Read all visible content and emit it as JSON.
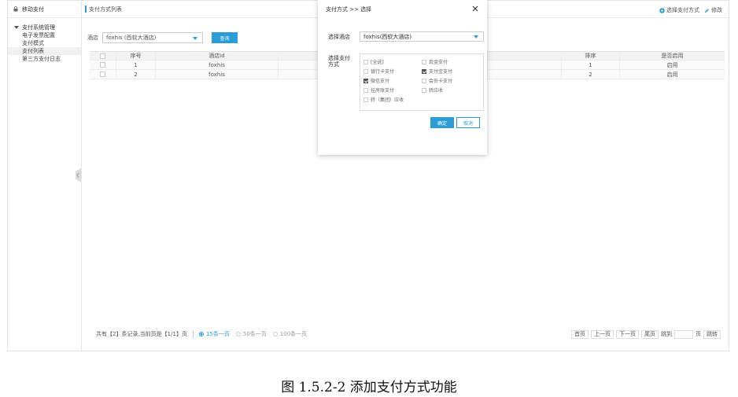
{
  "sidebar": {
    "header": "移动支付",
    "group": "支付系统管理",
    "items": [
      {
        "label": "电子发票配置",
        "active": false
      },
      {
        "label": "支付模式",
        "active": false
      },
      {
        "label": "支付列表",
        "active": true
      },
      {
        "label": "第三方支付日志",
        "active": false
      }
    ]
  },
  "topbar": {
    "title": "支付方式列表",
    "select_pay_label": "选择支付方式",
    "edit_label": "修改"
  },
  "filter": {
    "label": "酒店",
    "hotel_value": "foxhis (西软大酒店)",
    "query_label": "查询"
  },
  "table": {
    "headers": [
      "",
      "序号",
      "酒店id",
      "",
      "排序",
      "是否启用"
    ],
    "rows": [
      {
        "no": "1",
        "hotel": "foxhis",
        "sort": "1",
        "enabled": "启用"
      },
      {
        "no": "2",
        "hotel": "foxhis",
        "sort": "2",
        "enabled": "启用"
      }
    ]
  },
  "pager": {
    "info": "共有【2】条记录,当前页是【1/1】页",
    "per_page": [
      "15条一页",
      "50条一页",
      "100条一页"
    ],
    "first": "首页",
    "prev": "上一页",
    "next": "下一页",
    "last": "尾页",
    "jump_label": "跳到",
    "page_unit": "页",
    "go": "跳转"
  },
  "modal": {
    "title": "支付方式 >> 选择",
    "hotel_label": "选择酒店",
    "hotel_value": "foxhis(西软大酒店)",
    "method_label": "选择支付方式",
    "options": [
      {
        "label": "[全选]",
        "checked": false
      },
      {
        "label": "现金支付",
        "checked": false
      },
      {
        "label": "银行卡支付",
        "checked": false
      },
      {
        "label": "支付宝支付",
        "checked": true
      },
      {
        "label": "微信支付",
        "checked": true
      },
      {
        "label": "会员卡支付",
        "checked": false
      },
      {
        "label": "挂房账支付",
        "checked": false
      },
      {
        "label": "转应收",
        "checked": false
      },
      {
        "label": "转（集团）应收",
        "checked": false
      }
    ],
    "ok": "确定",
    "cancel": "取消"
  },
  "caption": "图 1.5.2-2 添加支付方式功能",
  "colors": {
    "accent": "#2b9dd6"
  }
}
